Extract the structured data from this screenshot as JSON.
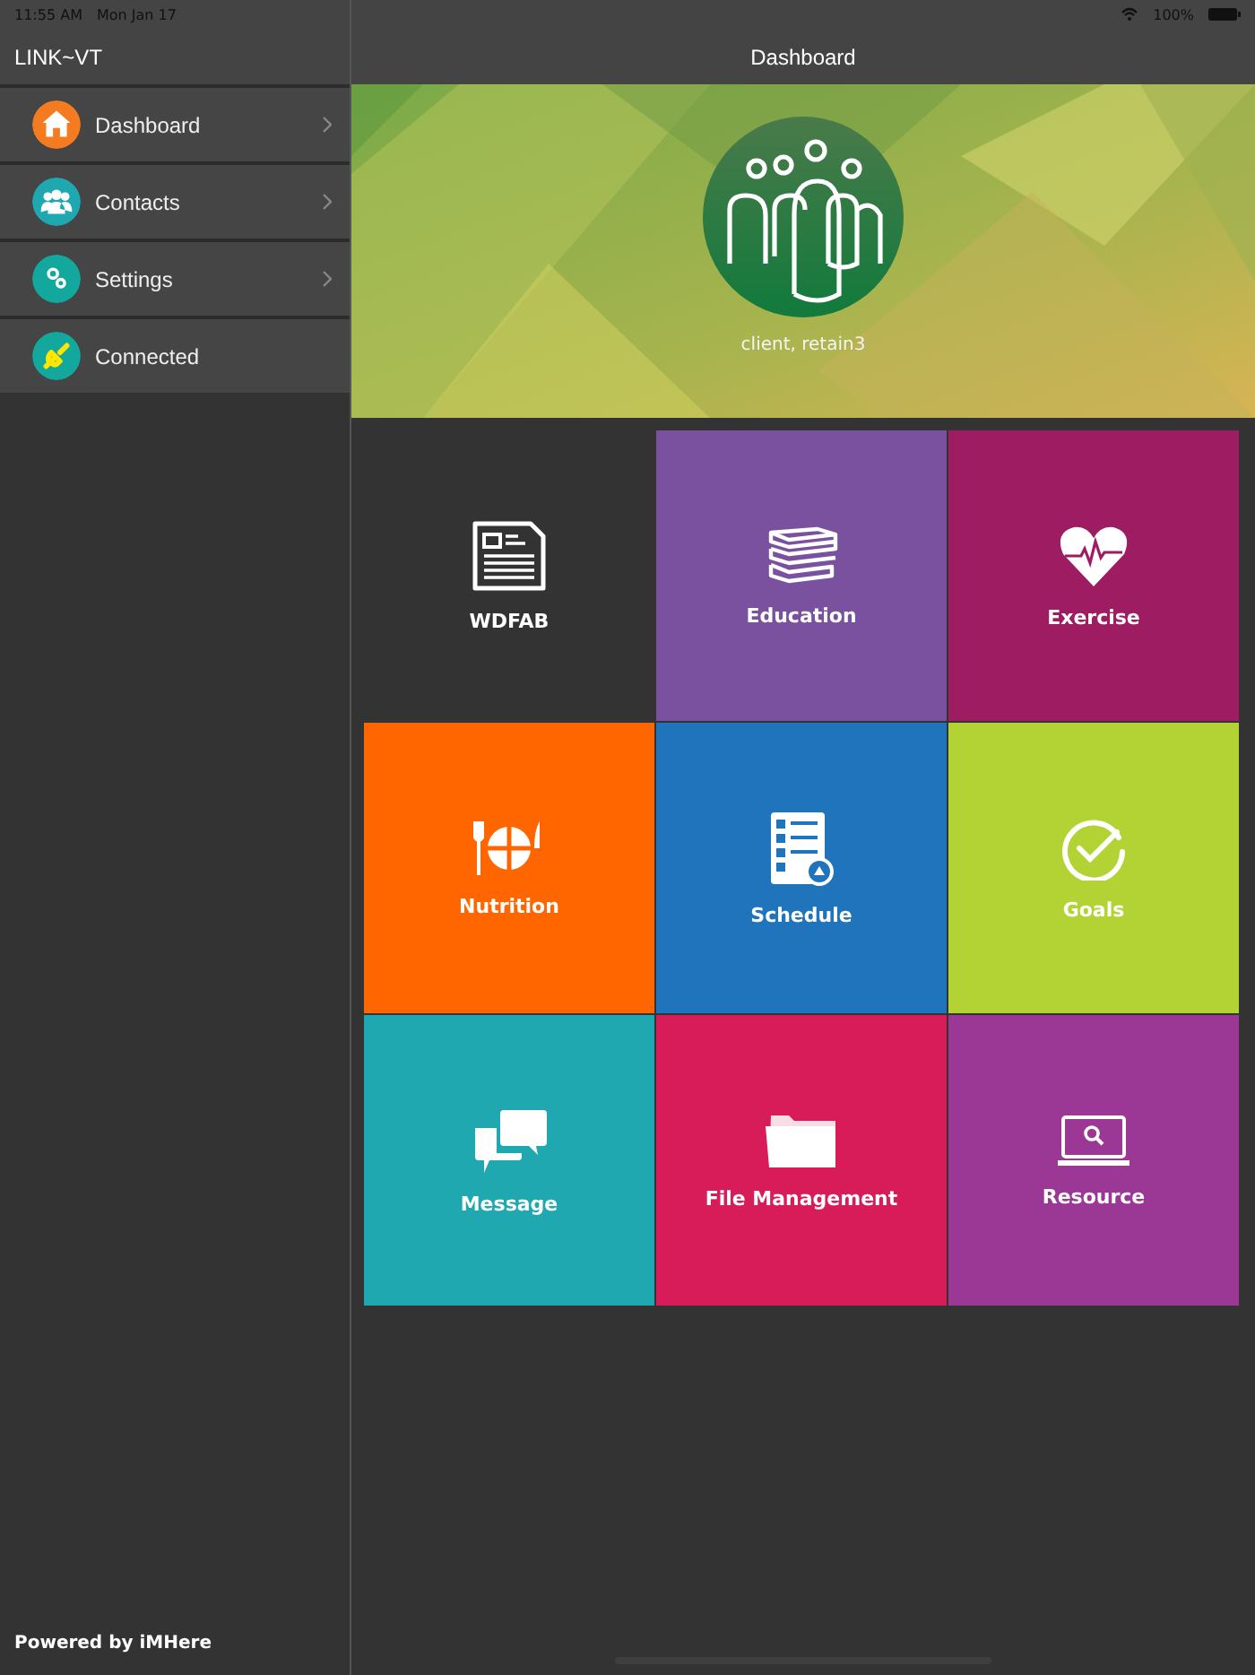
{
  "status_bar": {
    "time": "11:55 AM",
    "date": "Mon Jan 17",
    "battery": "100%"
  },
  "sidebar": {
    "title": "LINK~VT",
    "items": [
      {
        "label": "Dashboard",
        "kind": "home",
        "color": "#f47b20",
        "chevron": true
      },
      {
        "label": "Contacts",
        "kind": "people",
        "color": "#1fa8b0",
        "chevron": true
      },
      {
        "label": "Settings",
        "kind": "gears",
        "color": "#13a89e",
        "chevron": true
      },
      {
        "label": "Connected",
        "kind": "plug",
        "color": "#13a89e",
        "chevron": false
      }
    ],
    "footer": "Powered by iMHere"
  },
  "header": {
    "title": "Dashboard"
  },
  "banner": {
    "user": "client, retain3"
  },
  "tiles": [
    {
      "label": "WDFAB",
      "kind": "newspaper",
      "color": "#333333"
    },
    {
      "label": "Education",
      "kind": "books",
      "color": "#7a519f"
    },
    {
      "label": "Exercise",
      "kind": "heart",
      "color": "#9d1c62"
    },
    {
      "label": "Nutrition",
      "kind": "plate",
      "color": "#ff6600"
    },
    {
      "label": "Schedule",
      "kind": "checklist",
      "color": "#1f74bb"
    },
    {
      "label": "Goals",
      "kind": "check",
      "color": "#b3d334"
    },
    {
      "label": "Message",
      "kind": "chat",
      "color": "#1fa8b0"
    },
    {
      "label": "File Management",
      "kind": "folder",
      "color": "#d81c5a"
    },
    {
      "label": "Resource",
      "kind": "laptop",
      "color": "#9b3794"
    }
  ]
}
